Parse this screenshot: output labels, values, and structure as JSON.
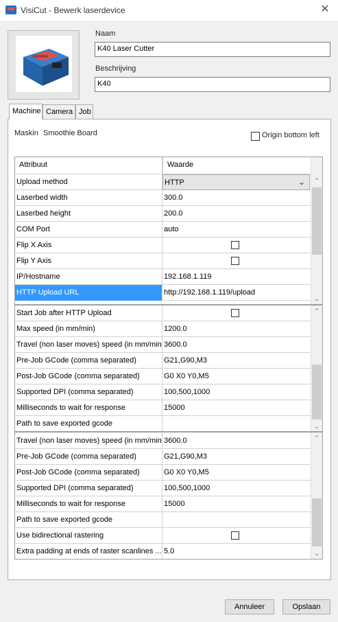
{
  "window": {
    "title": "VisiCut - Bewerk laserdevice",
    "close_icon": "close-icon"
  },
  "device": {
    "name_label": "Naam",
    "name_value": "K40 Laser Cutter",
    "description_label": "Beschrijving",
    "description_value": "K40"
  },
  "tabs": [
    {
      "label": "Machine"
    },
    {
      "label": "Camera"
    },
    {
      "label": "Job"
    }
  ],
  "machine": {
    "driver_label": "Maskin",
    "driver_value": "Smoothie Board",
    "origin_label": "Origin bottom left",
    "origin_checked": false
  },
  "table": {
    "header": {
      "attribute": "Attribuut",
      "value": "Waarde"
    },
    "block1": [
      {
        "attr": "Upload method",
        "value": "HTTP",
        "kind": "dropdown"
      },
      {
        "attr": "Laserbed width",
        "value": "300.0"
      },
      {
        "attr": "Laserbed height",
        "value": "200.0"
      },
      {
        "attr": "COM Port",
        "value": "auto"
      },
      {
        "attr": "Flip X Axis",
        "value": "",
        "kind": "checkbox"
      },
      {
        "attr": "Flip Y Axis",
        "value": "",
        "kind": "checkbox"
      },
      {
        "attr": "IP/Hostname",
        "value": "192.168.1.119"
      },
      {
        "attr": "HTTP Upload URL",
        "value": "http://192.168.1.119/upload",
        "selected": true
      }
    ],
    "block2": [
      {
        "attr": "Start Job after HTTP Upload",
        "value": "",
        "kind": "checkbox"
      },
      {
        "attr": "Max speed (in mm/min)",
        "value": "1200.0"
      },
      {
        "attr": "Travel (non laser moves) speed (in mm/min)",
        "value": "3600.0"
      },
      {
        "attr": "Pre-Job GCode (comma separated)",
        "value": "G21,G90,M3"
      },
      {
        "attr": "Post-Job GCode (comma separated)",
        "value": "G0 X0 Y0,M5"
      },
      {
        "attr": "Supported DPI (comma separated)",
        "value": "100,500,1000"
      },
      {
        "attr": "Milliseconds to wait for response",
        "value": "15000"
      },
      {
        "attr": "Path to save exported gcode",
        "value": ""
      }
    ],
    "block3": [
      {
        "attr": "Travel (non laser moves) speed (in mm/min)",
        "value": "3600.0"
      },
      {
        "attr": "Pre-Job GCode (comma separated)",
        "value": "G21,G90,M3"
      },
      {
        "attr": "Post-Job GCode (comma separated)",
        "value": "G0 X0 Y0,M5"
      },
      {
        "attr": "Supported DPI (comma separated)",
        "value": "100,500,1000"
      },
      {
        "attr": "Milliseconds to wait for response",
        "value": "15000"
      },
      {
        "attr": "Path to save exported gcode",
        "value": ""
      },
      {
        "attr": "Use bidirectional rastering",
        "value": "",
        "kind": "checkbox"
      },
      {
        "attr": "Extra padding at ends of raster scanlines ...",
        "value": "5.0"
      }
    ]
  },
  "buttons": {
    "cancel": "Annuleer",
    "save": "Opslaan"
  }
}
